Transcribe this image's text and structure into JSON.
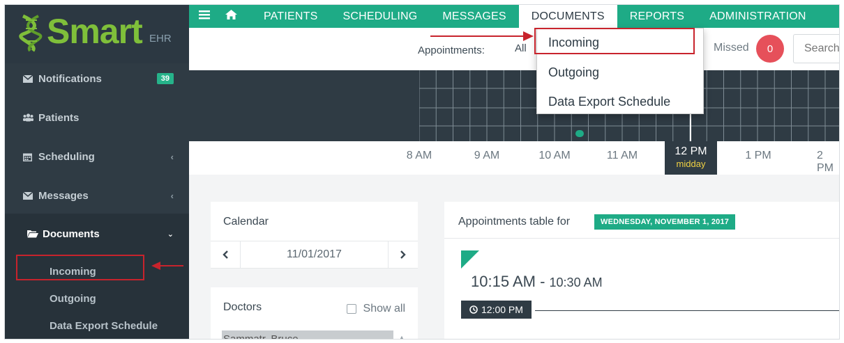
{
  "brand": {
    "name": "Smart",
    "suffix": "EHR"
  },
  "sidebar": {
    "items": [
      {
        "label": "Notifications",
        "icon": "envelope-icon",
        "badge": "39"
      },
      {
        "label": "Patients",
        "icon": "users-icon"
      },
      {
        "label": "Scheduling",
        "icon": "calendar-icon"
      },
      {
        "label": "Messages",
        "icon": "envelope-icon"
      },
      {
        "label": "Documents",
        "icon": "folder-open-icon"
      }
    ],
    "documents_sub": [
      "Incoming",
      "Outgoing",
      "Data Export Schedule"
    ]
  },
  "topnav": {
    "items": [
      "PATIENTS",
      "SCHEDULING",
      "MESSAGES",
      "DOCUMENTS",
      "REPORTS",
      "ADMINISTRATION"
    ],
    "active": "DOCUMENTS"
  },
  "dropdown": {
    "items": [
      "Incoming",
      "Outgoing",
      "Data Export Schedule"
    ]
  },
  "header": {
    "appointments_label": "Appointments:",
    "appointments_filter": "All",
    "missed_label": "Missed",
    "missed_count": "0",
    "search_placeholder": "Search"
  },
  "timeline": {
    "ticks": [
      "8 AM",
      "9 AM",
      "10 AM",
      "11 AM",
      "12 PM",
      "1 PM",
      "2 PM"
    ],
    "noon_sub": "midday"
  },
  "calendar": {
    "title": "Calendar",
    "date": "11/01/2017"
  },
  "doctors": {
    "title": "Doctors",
    "show_all": "Show all",
    "list": [
      "Sammatr, Bruce"
    ]
  },
  "appointments": {
    "title": "Appointments table for",
    "date_badge": "WEDNESDAY, NOVEMBER 1, 2017",
    "slot_start": "10:15 AM",
    "slot_sep": "-",
    "slot_end": "10:30 AM",
    "chip_time": "12:00 PM"
  },
  "colors": {
    "accent": "#1eab86",
    "sidebar": "#2f3b44",
    "alert": "#e6505a",
    "highlight": "#c8232c"
  }
}
